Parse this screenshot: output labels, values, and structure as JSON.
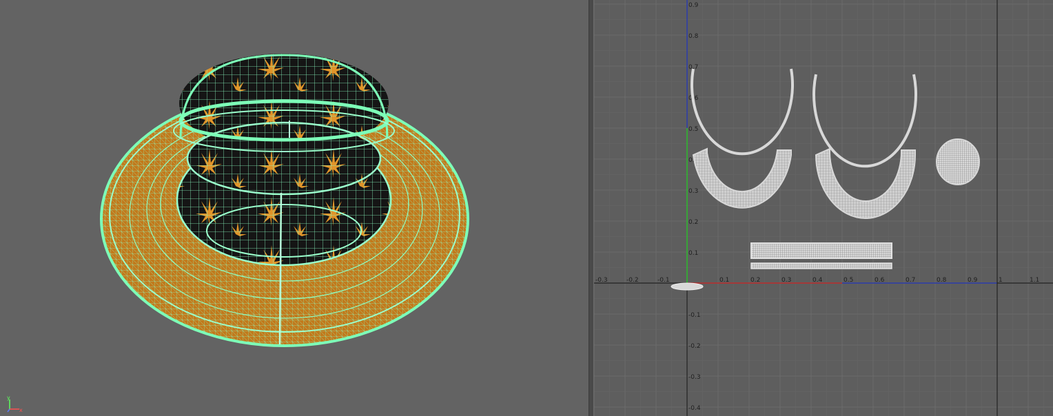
{
  "viewport_3d": {
    "model": "bucket-hat",
    "wireframe_color": "#7dffb8",
    "texture_color": "#e0952a",
    "texture_bg": "#1a1a1a"
  },
  "axis_gizmo": {
    "y_label": "y",
    "z_label": "z",
    "x_label": "x"
  },
  "uv_editor": {
    "x_tick_labels": [
      "-0.3",
      "-0.2",
      "-0.1",
      "0.1",
      "0.2",
      "0.3",
      "0.4",
      "0.5",
      "0.6",
      "0.7",
      "0.8",
      "0.9",
      "1",
      "1.1"
    ],
    "y_tick_labels_pos": [
      "0.9",
      "0.8",
      "0.7",
      "0.6",
      "0.5",
      "0.4",
      "0.3",
      "0.2",
      "0.1"
    ],
    "y_tick_labels_neg": [
      "-0.1",
      "-0.2",
      "-0.3",
      "-0.4"
    ],
    "shells": [
      "crown-ring-left",
      "crown-ring-right",
      "brim-arc-left",
      "brim-arc-right",
      "top-disc",
      "band-strip-wide",
      "band-strip-thin",
      "small-ellipse"
    ]
  }
}
